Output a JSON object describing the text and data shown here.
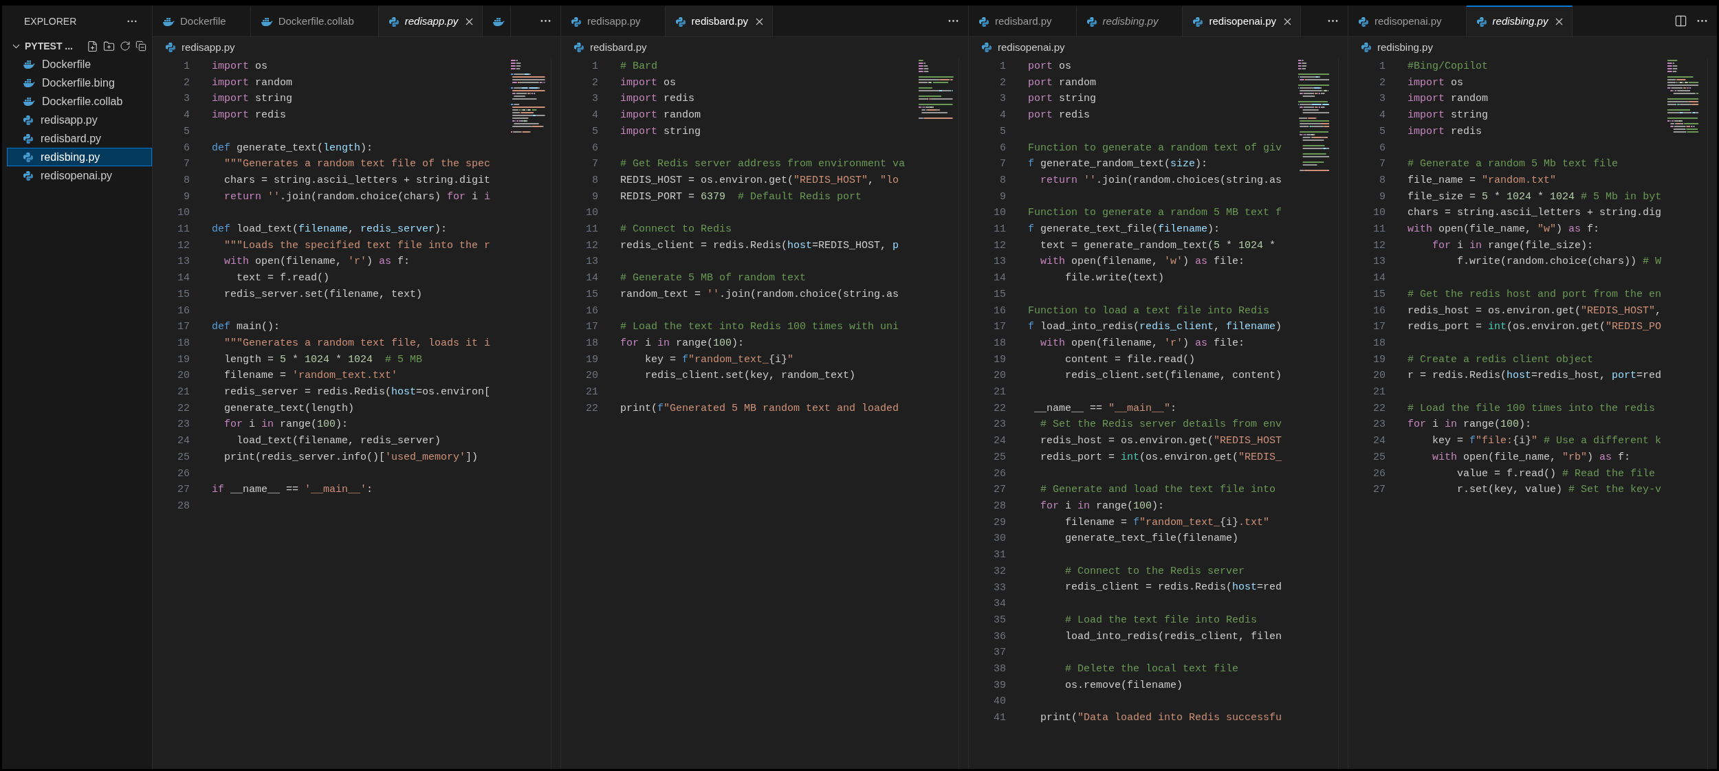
{
  "sidebar": {
    "title": "EXPLORER",
    "section": {
      "label": "PYTEST ...",
      "expanded": true
    },
    "files": [
      {
        "name": "Dockerfile",
        "kind": "docker",
        "selected": false
      },
      {
        "name": "Dockerfile.bing",
        "kind": "docker",
        "selected": false
      },
      {
        "name": "Dockerfile.collab",
        "kind": "docker",
        "selected": false
      },
      {
        "name": "redisapp.py",
        "kind": "python",
        "selected": false
      },
      {
        "name": "redisbard.py",
        "kind": "python",
        "selected": false
      },
      {
        "name": "redisbing.py",
        "kind": "python",
        "selected": true
      },
      {
        "name": "redisopenai.py",
        "kind": "python",
        "selected": false
      }
    ]
  },
  "editor_groups": [
    {
      "focused": false,
      "split_action": false,
      "tabs": [
        {
          "label": "Dockerfile",
          "kind": "docker",
          "selected": false,
          "preview": false
        },
        {
          "label": "Dockerfile.collab",
          "kind": "docker",
          "selected": false,
          "preview": false
        },
        {
          "label": "redisapp.py",
          "kind": "python",
          "selected": true,
          "preview": true
        },
        {
          "kind": "docker",
          "selected": false
        }
      ],
      "breadcrumb": {
        "label": "redisapp.py",
        "kind": "python"
      },
      "lines": [
        {
          "number": "1",
          "tokens": [
            {
              "kind": "kw",
              "text": "import"
            },
            {
              "kind": "txt",
              "text": " os"
            }
          ]
        },
        {
          "number": "2",
          "tokens": [
            {
              "kind": "kw",
              "text": "import"
            },
            {
              "kind": "txt",
              "text": " random"
            }
          ]
        },
        {
          "number": "3",
          "tokens": [
            {
              "kind": "kw",
              "text": "import"
            },
            {
              "kind": "txt",
              "text": " string"
            }
          ]
        },
        {
          "number": "4",
          "tokens": [
            {
              "kind": "kw",
              "text": "import"
            },
            {
              "kind": "txt",
              "text": " redis"
            }
          ]
        },
        {
          "number": "5"
        },
        {
          "number": "6",
          "tokens": [
            {
              "kind": "def",
              "text": "def"
            },
            {
              "kind": "txt",
              "text": " generate_text("
            },
            {
              "kind": "arg",
              "text": "length"
            },
            {
              "kind": "txt",
              "text": "):"
            }
          ]
        },
        {
          "number": "7",
          "tokens": [
            {
              "kind": "str",
              "text": "  \"\"\"Generates a random text file of the spec"
            }
          ]
        },
        {
          "number": "8",
          "tokens": [
            {
              "kind": "txt",
              "text": "  chars = string.ascii_letters + string.digit"
            }
          ]
        },
        {
          "number": "9",
          "tokens": [
            {
              "kind": "kw",
              "text": "  return"
            },
            {
              "kind": "str",
              "text": " ''"
            },
            {
              "kind": "txt",
              "text": ".join(random.choice(chars) "
            },
            {
              "kind": "kw",
              "text": "for"
            },
            {
              "kind": "txt",
              "text": " i "
            },
            {
              "kind": "kw",
              "text": "i"
            }
          ]
        },
        {
          "number": "10"
        },
        {
          "number": "11",
          "tokens": [
            {
              "kind": "def",
              "text": "def"
            },
            {
              "kind": "txt",
              "text": " load_text("
            },
            {
              "kind": "arg",
              "text": "filename"
            },
            {
              "kind": "txt",
              "text": ", "
            },
            {
              "kind": "arg",
              "text": "redis_server"
            },
            {
              "kind": "txt",
              "text": "):"
            }
          ]
        },
        {
          "number": "12",
          "tokens": [
            {
              "kind": "str",
              "text": "  \"\"\"Loads the specified text file into the r"
            }
          ]
        },
        {
          "number": "13",
          "tokens": [
            {
              "kind": "kw",
              "text": "  with"
            },
            {
              "kind": "txt",
              "text": " open(filename, "
            },
            {
              "kind": "str",
              "text": "'r'"
            },
            {
              "kind": "txt",
              "text": ") "
            },
            {
              "kind": "kw",
              "text": "as"
            },
            {
              "kind": "txt",
              "text": " f:"
            }
          ]
        },
        {
          "number": "14",
          "tokens": [
            {
              "kind": "txt",
              "text": "    text = f.read()"
            }
          ]
        },
        {
          "number": "15",
          "tokens": [
            {
              "kind": "txt",
              "text": "  redis_server.set(filename, text)"
            }
          ]
        },
        {
          "number": "16"
        },
        {
          "number": "17",
          "tokens": [
            {
              "kind": "def",
              "text": "def"
            },
            {
              "kind": "txt",
              "text": " main():"
            }
          ]
        },
        {
          "number": "18",
          "tokens": [
            {
              "kind": "str",
              "text": "  \"\"\"Generates a random text file, loads it i"
            }
          ]
        },
        {
          "number": "19",
          "tokens": [
            {
              "kind": "txt",
              "text": "  length = "
            },
            {
              "kind": "num",
              "text": "5"
            },
            {
              "kind": "txt",
              "text": " * "
            },
            {
              "kind": "num",
              "text": "1024"
            },
            {
              "kind": "txt",
              "text": " * "
            },
            {
              "kind": "num",
              "text": "1024"
            },
            {
              "kind": "com",
              "text": "  # 5 MB"
            }
          ]
        },
        {
          "number": "20",
          "tokens": [
            {
              "kind": "txt",
              "text": "  filename = "
            },
            {
              "kind": "str",
              "text": "'random_text.txt'"
            }
          ]
        },
        {
          "number": "21",
          "tokens": [
            {
              "kind": "txt",
              "text": "  redis_server = redis.Redis("
            },
            {
              "kind": "arg",
              "text": "host"
            },
            {
              "kind": "txt",
              "text": "=os.environ["
            }
          ]
        },
        {
          "number": "22",
          "tokens": [
            {
              "kind": "txt",
              "text": "  generate_text(length)"
            }
          ]
        },
        {
          "number": "23",
          "tokens": [
            {
              "kind": "kw",
              "text": "  for"
            },
            {
              "kind": "txt",
              "text": " i "
            },
            {
              "kind": "kw",
              "text": "in"
            },
            {
              "kind": "txt",
              "text": " range("
            },
            {
              "kind": "num",
              "text": "100"
            },
            {
              "kind": "txt",
              "text": "):"
            }
          ]
        },
        {
          "number": "24",
          "tokens": [
            {
              "kind": "txt",
              "text": "    load_text(filename, redis_server)"
            }
          ]
        },
        {
          "number": "25",
          "tokens": [
            {
              "kind": "txt",
              "text": "  print(redis_server.info()["
            },
            {
              "kind": "str",
              "text": "'used_memory'"
            },
            {
              "kind": "txt",
              "text": "])"
            }
          ]
        },
        {
          "number": "26"
        },
        {
          "number": "27",
          "tokens": [
            {
              "kind": "kw",
              "text": "if"
            },
            {
              "kind": "txt",
              "text": " __name__ == "
            },
            {
              "kind": "str",
              "text": "'__main__'"
            },
            {
              "kind": "txt",
              "text": ":"
            }
          ]
        },
        {
          "number": "28"
        }
      ]
    },
    {
      "focused": false,
      "split_action": false,
      "tabs": [
        {
          "label": "redisapp.py",
          "kind": "python",
          "selected": false,
          "preview": false
        },
        {
          "label": "redisbard.py",
          "kind": "python",
          "selected": true,
          "preview": false
        }
      ],
      "breadcrumb": {
        "label": "redisbard.py",
        "kind": "python"
      },
      "lines": [
        {
          "number": "1",
          "tokens": [
            {
              "kind": "com",
              "text": "# Bard"
            }
          ]
        },
        {
          "number": "2",
          "tokens": [
            {
              "kind": "kw",
              "text": "import"
            },
            {
              "kind": "txt",
              "text": " os"
            }
          ]
        },
        {
          "number": "3",
          "tokens": [
            {
              "kind": "kw",
              "text": "import"
            },
            {
              "kind": "txt",
              "text": " redis"
            }
          ]
        },
        {
          "number": "4",
          "tokens": [
            {
              "kind": "kw",
              "text": "import"
            },
            {
              "kind": "txt",
              "text": " random"
            }
          ]
        },
        {
          "number": "5",
          "tokens": [
            {
              "kind": "kw",
              "text": "import"
            },
            {
              "kind": "txt",
              "text": " string"
            }
          ]
        },
        {
          "number": "6"
        },
        {
          "number": "7",
          "tokens": [
            {
              "kind": "com",
              "text": "# Get Redis server address from environment va"
            }
          ]
        },
        {
          "number": "8",
          "tokens": [
            {
              "kind": "txt",
              "text": "REDIS_HOST = os.environ.get("
            },
            {
              "kind": "str",
              "text": "\"REDIS_HOST\""
            },
            {
              "kind": "txt",
              "text": ", "
            },
            {
              "kind": "str",
              "text": "\"lo"
            }
          ]
        },
        {
          "number": "9",
          "tokens": [
            {
              "kind": "txt",
              "text": "REDIS_PORT = "
            },
            {
              "kind": "num",
              "text": "6379"
            },
            {
              "kind": "com",
              "text": "  # Default Redis port"
            }
          ]
        },
        {
          "number": "10"
        },
        {
          "number": "11",
          "tokens": [
            {
              "kind": "com",
              "text": "# Connect to Redis"
            }
          ]
        },
        {
          "number": "12",
          "tokens": [
            {
              "kind": "txt",
              "text": "redis_client = redis.Redis("
            },
            {
              "kind": "arg",
              "text": "host"
            },
            {
              "kind": "txt",
              "text": "=REDIS_HOST, "
            },
            {
              "kind": "arg",
              "text": "p"
            }
          ]
        },
        {
          "number": "13"
        },
        {
          "number": "14",
          "tokens": [
            {
              "kind": "com",
              "text": "# Generate 5 MB of random text"
            }
          ]
        },
        {
          "number": "15",
          "tokens": [
            {
              "kind": "txt",
              "text": "random_text = "
            },
            {
              "kind": "str",
              "text": "''"
            },
            {
              "kind": "txt",
              "text": ".join(random.choice(string.as"
            }
          ]
        },
        {
          "number": "16"
        },
        {
          "number": "17",
          "tokens": [
            {
              "kind": "com",
              "text": "# Load the text into Redis 100 times with uni"
            }
          ]
        },
        {
          "number": "18",
          "tokens": [
            {
              "kind": "kw",
              "text": "for"
            },
            {
              "kind": "txt",
              "text": " i "
            },
            {
              "kind": "kw",
              "text": "in"
            },
            {
              "kind": "txt",
              "text": " range("
            },
            {
              "kind": "num",
              "text": "100"
            },
            {
              "kind": "txt",
              "text": "):"
            }
          ]
        },
        {
          "number": "19",
          "tokens": [
            {
              "kind": "txt",
              "text": "    key = "
            },
            {
              "kind": "def",
              "text": "f"
            },
            {
              "kind": "str",
              "text": "\"random_text_"
            },
            {
              "kind": "txt",
              "text": "{i}"
            },
            {
              "kind": "str",
              "text": "\""
            }
          ]
        },
        {
          "number": "20",
          "tokens": [
            {
              "kind": "txt",
              "text": "    redis_client.set(key, random_text)"
            }
          ]
        },
        {
          "number": "21"
        },
        {
          "number": "22",
          "tokens": [
            {
              "kind": "txt",
              "text": "print("
            },
            {
              "kind": "def",
              "text": "f"
            },
            {
              "kind": "str",
              "text": "\"Generated 5 MB random text and loaded"
            }
          ]
        }
      ]
    },
    {
      "focused": false,
      "split_action": false,
      "tabs": [
        {
          "label": "redisbard.py",
          "kind": "python",
          "selected": false,
          "preview": false
        },
        {
          "label": "redisbing.py",
          "kind": "python",
          "selected": false,
          "preview": true
        },
        {
          "label": "redisopenai.py",
          "kind": "python",
          "selected": true,
          "preview": false
        }
      ],
      "breadcrumb": {
        "label": "redisopenai.py",
        "kind": "python"
      },
      "lines": [
        {
          "number": "1",
          "tokens": [
            {
              "kind": "kw",
              "text": "port"
            },
            {
              "kind": "txt",
              "text": " os"
            }
          ]
        },
        {
          "number": "2",
          "tokens": [
            {
              "kind": "kw",
              "text": "port"
            },
            {
              "kind": "txt",
              "text": " random"
            }
          ]
        },
        {
          "number": "3",
          "tokens": [
            {
              "kind": "kw",
              "text": "port"
            },
            {
              "kind": "txt",
              "text": " string"
            }
          ]
        },
        {
          "number": "4",
          "tokens": [
            {
              "kind": "kw",
              "text": "port"
            },
            {
              "kind": "txt",
              "text": " redis"
            }
          ]
        },
        {
          "number": "5"
        },
        {
          "number": "6",
          "tokens": [
            {
              "kind": "com",
              "text": "Function to generate a random text of giv"
            }
          ]
        },
        {
          "number": "7",
          "tokens": [
            {
              "kind": "def",
              "text": "f"
            },
            {
              "kind": "txt",
              "text": " generate_random_text("
            },
            {
              "kind": "arg",
              "text": "size"
            },
            {
              "kind": "txt",
              "text": "):"
            }
          ]
        },
        {
          "number": "8",
          "tokens": [
            {
              "kind": "kw",
              "text": "  return"
            },
            {
              "kind": "str",
              "text": " ''"
            },
            {
              "kind": "txt",
              "text": ".join(random.choices(string.as"
            }
          ]
        },
        {
          "number": "9"
        },
        {
          "number": "10",
          "tokens": [
            {
              "kind": "com",
              "text": "Function to generate a random 5 MB text f"
            }
          ]
        },
        {
          "number": "11",
          "tokens": [
            {
              "kind": "def",
              "text": "f"
            },
            {
              "kind": "txt",
              "text": " generate_text_file("
            },
            {
              "kind": "arg",
              "text": "filename"
            },
            {
              "kind": "txt",
              "text": "):"
            }
          ]
        },
        {
          "number": "12",
          "tokens": [
            {
              "kind": "txt",
              "text": "  text = generate_random_text("
            },
            {
              "kind": "num",
              "text": "5"
            },
            {
              "kind": "txt",
              "text": " * "
            },
            {
              "kind": "num",
              "text": "1024"
            },
            {
              "kind": "txt",
              "text": " *"
            }
          ]
        },
        {
          "number": "13",
          "tokens": [
            {
              "kind": "kw",
              "text": "  with"
            },
            {
              "kind": "txt",
              "text": " open(filename, "
            },
            {
              "kind": "str",
              "text": "'w'"
            },
            {
              "kind": "txt",
              "text": ") "
            },
            {
              "kind": "kw",
              "text": "as"
            },
            {
              "kind": "txt",
              "text": " file:"
            }
          ]
        },
        {
          "number": "14",
          "tokens": [
            {
              "kind": "txt",
              "text": "      file.write(text)"
            }
          ]
        },
        {
          "number": "15"
        },
        {
          "number": "16",
          "tokens": [
            {
              "kind": "com",
              "text": "Function to load a text file into Redis"
            }
          ]
        },
        {
          "number": "17",
          "tokens": [
            {
              "kind": "def",
              "text": "f"
            },
            {
              "kind": "txt",
              "text": " load_into_redis("
            },
            {
              "kind": "arg",
              "text": "redis_client"
            },
            {
              "kind": "txt",
              "text": ", "
            },
            {
              "kind": "arg",
              "text": "filename"
            },
            {
              "kind": "txt",
              "text": ")"
            }
          ]
        },
        {
          "number": "18",
          "tokens": [
            {
              "kind": "kw",
              "text": "  with"
            },
            {
              "kind": "txt",
              "text": " open(filename, "
            },
            {
              "kind": "str",
              "text": "'r'"
            },
            {
              "kind": "txt",
              "text": ") "
            },
            {
              "kind": "kw",
              "text": "as"
            },
            {
              "kind": "txt",
              "text": " file:"
            }
          ]
        },
        {
          "number": "19",
          "tokens": [
            {
              "kind": "txt",
              "text": "      content = file.read()"
            }
          ]
        },
        {
          "number": "20",
          "tokens": [
            {
              "kind": "txt",
              "text": "      redis_client.set(filename, content)"
            }
          ]
        },
        {
          "number": "21"
        },
        {
          "number": "22",
          "tokens": [
            {
              "kind": "txt",
              "text": " __name__ == "
            },
            {
              "kind": "str",
              "text": "\"__main__\""
            },
            {
              "kind": "txt",
              "text": ":"
            }
          ]
        },
        {
          "number": "23",
          "tokens": [
            {
              "kind": "com",
              "text": "  # Set the Redis server details from env"
            }
          ]
        },
        {
          "number": "24",
          "tokens": [
            {
              "kind": "txt",
              "text": "  redis_host = os.environ.get("
            },
            {
              "kind": "str",
              "text": "\"REDIS_HOST"
            }
          ]
        },
        {
          "number": "25",
          "tokens": [
            {
              "kind": "txt",
              "text": "  redis_port = "
            },
            {
              "kind": "type",
              "text": "int"
            },
            {
              "kind": "txt",
              "text": "(os.environ.get("
            },
            {
              "kind": "str",
              "text": "\"REDIS_"
            }
          ]
        },
        {
          "number": "26"
        },
        {
          "number": "27",
          "tokens": [
            {
              "kind": "com",
              "text": "  # Generate and load the text file into"
            }
          ]
        },
        {
          "number": "28",
          "tokens": [
            {
              "kind": "kw",
              "text": "  for"
            },
            {
              "kind": "txt",
              "text": " i "
            },
            {
              "kind": "kw",
              "text": "in"
            },
            {
              "kind": "txt",
              "text": " range("
            },
            {
              "kind": "num",
              "text": "100"
            },
            {
              "kind": "txt",
              "text": "):"
            }
          ]
        },
        {
          "number": "29",
          "tokens": [
            {
              "kind": "txt",
              "text": "      filename = "
            },
            {
              "kind": "def",
              "text": "f"
            },
            {
              "kind": "str",
              "text": "\"random_text_"
            },
            {
              "kind": "txt",
              "text": "{i}"
            },
            {
              "kind": "str",
              "text": ".txt\""
            }
          ]
        },
        {
          "number": "30",
          "tokens": [
            {
              "kind": "txt",
              "text": "      generate_text_file(filename)"
            }
          ]
        },
        {
          "number": "31"
        },
        {
          "number": "32",
          "tokens": [
            {
              "kind": "com",
              "text": "      # Connect to the Redis server"
            }
          ]
        },
        {
          "number": "33",
          "tokens": [
            {
              "kind": "txt",
              "text": "      redis_client = redis.Redis("
            },
            {
              "kind": "arg",
              "text": "host"
            },
            {
              "kind": "txt",
              "text": "=red"
            }
          ]
        },
        {
          "number": "34"
        },
        {
          "number": "35",
          "tokens": [
            {
              "kind": "com",
              "text": "      # Load the text file into Redis"
            }
          ]
        },
        {
          "number": "36",
          "tokens": [
            {
              "kind": "txt",
              "text": "      load_into_redis(redis_client, filen"
            }
          ]
        },
        {
          "number": "37"
        },
        {
          "number": "38",
          "tokens": [
            {
              "kind": "com",
              "text": "      # Delete the local text file"
            }
          ]
        },
        {
          "number": "39",
          "tokens": [
            {
              "kind": "txt",
              "text": "      os.remove(filename)"
            }
          ]
        },
        {
          "number": "40"
        },
        {
          "number": "41",
          "tokens": [
            {
              "kind": "txt",
              "text": "  print("
            },
            {
              "kind": "str",
              "text": "\"Data loaded into Redis successfu"
            }
          ]
        }
      ]
    },
    {
      "focused": true,
      "split_action": true,
      "tabs": [
        {
          "label": "redisopenai.py",
          "kind": "python",
          "selected": false,
          "preview": false
        },
        {
          "label": "redisbing.py",
          "kind": "python",
          "selected": true,
          "preview": true
        }
      ],
      "breadcrumb": {
        "label": "redisbing.py",
        "kind": "python"
      },
      "lines": [
        {
          "number": "1",
          "tokens": [
            {
              "kind": "com",
              "text": "#Bing/Copilot"
            }
          ]
        },
        {
          "number": "2",
          "tokens": [
            {
              "kind": "kw",
              "text": "import"
            },
            {
              "kind": "txt",
              "text": " os"
            }
          ]
        },
        {
          "number": "3",
          "tokens": [
            {
              "kind": "kw",
              "text": "import"
            },
            {
              "kind": "txt",
              "text": " random"
            }
          ]
        },
        {
          "number": "4",
          "tokens": [
            {
              "kind": "kw",
              "text": "import"
            },
            {
              "kind": "txt",
              "text": " string"
            }
          ]
        },
        {
          "number": "5",
          "tokens": [
            {
              "kind": "kw",
              "text": "import"
            },
            {
              "kind": "txt",
              "text": " redis"
            }
          ]
        },
        {
          "number": "6"
        },
        {
          "number": "7",
          "tokens": [
            {
              "kind": "com",
              "text": "# Generate a random 5 Mb text file"
            }
          ]
        },
        {
          "number": "8",
          "tokens": [
            {
              "kind": "txt",
              "text": "file_name = "
            },
            {
              "kind": "str",
              "text": "\"random.txt\""
            }
          ]
        },
        {
          "number": "9",
          "tokens": [
            {
              "kind": "txt",
              "text": "file_size = "
            },
            {
              "kind": "num",
              "text": "5"
            },
            {
              "kind": "txt",
              "text": " * "
            },
            {
              "kind": "num",
              "text": "1024"
            },
            {
              "kind": "txt",
              "text": " * "
            },
            {
              "kind": "num",
              "text": "1024"
            },
            {
              "kind": "com",
              "text": " # 5 Mb in byt"
            }
          ]
        },
        {
          "number": "10",
          "tokens": [
            {
              "kind": "txt",
              "text": "chars = string.ascii_letters + string.dig"
            }
          ]
        },
        {
          "number": "11",
          "tokens": [
            {
              "kind": "kw",
              "text": "with"
            },
            {
              "kind": "txt",
              "text": " open(file_name, "
            },
            {
              "kind": "str",
              "text": "\"w\""
            },
            {
              "kind": "txt",
              "text": ") "
            },
            {
              "kind": "kw",
              "text": "as"
            },
            {
              "kind": "txt",
              "text": " f:"
            }
          ]
        },
        {
          "number": "12",
          "tokens": [
            {
              "kind": "kw",
              "text": "    for"
            },
            {
              "kind": "txt",
              "text": " i "
            },
            {
              "kind": "kw",
              "text": "in"
            },
            {
              "kind": "txt",
              "text": " range(file_size):"
            }
          ]
        },
        {
          "number": "13",
          "tokens": [
            {
              "kind": "txt",
              "text": "        f.write(random.choice(chars)) "
            },
            {
              "kind": "com",
              "text": "# W"
            }
          ]
        },
        {
          "number": "14"
        },
        {
          "number": "15",
          "tokens": [
            {
              "kind": "com",
              "text": "# Get the redis host and port from the en"
            }
          ]
        },
        {
          "number": "16",
          "tokens": [
            {
              "kind": "txt",
              "text": "redis_host = os.environ.get("
            },
            {
              "kind": "str",
              "text": "\"REDIS_HOST\""
            },
            {
              "kind": "txt",
              "text": ","
            }
          ]
        },
        {
          "number": "17",
          "tokens": [
            {
              "kind": "txt",
              "text": "redis_port = "
            },
            {
              "kind": "type",
              "text": "int"
            },
            {
              "kind": "txt",
              "text": "(os.environ.get("
            },
            {
              "kind": "str",
              "text": "\"REDIS_PO"
            }
          ]
        },
        {
          "number": "18"
        },
        {
          "number": "19",
          "tokens": [
            {
              "kind": "com",
              "text": "# Create a redis client object"
            }
          ]
        },
        {
          "number": "20",
          "tokens": [
            {
              "kind": "txt",
              "text": "r = redis.Redis("
            },
            {
              "kind": "arg",
              "text": "host"
            },
            {
              "kind": "txt",
              "text": "=redis_host, "
            },
            {
              "kind": "arg",
              "text": "port"
            },
            {
              "kind": "txt",
              "text": "=red"
            }
          ]
        },
        {
          "number": "21"
        },
        {
          "number": "22",
          "tokens": [
            {
              "kind": "com",
              "text": "# Load the file 100 times into the redis"
            }
          ]
        },
        {
          "number": "23",
          "tokens": [
            {
              "kind": "kw",
              "text": "for"
            },
            {
              "kind": "txt",
              "text": " i "
            },
            {
              "kind": "kw",
              "text": "in"
            },
            {
              "kind": "txt",
              "text": " range("
            },
            {
              "kind": "num",
              "text": "100"
            },
            {
              "kind": "txt",
              "text": "):"
            }
          ]
        },
        {
          "number": "24",
          "tokens": [
            {
              "kind": "txt",
              "text": "    key = "
            },
            {
              "kind": "def",
              "text": "f"
            },
            {
              "kind": "str",
              "text": "\"file:"
            },
            {
              "kind": "txt",
              "text": "{i}"
            },
            {
              "kind": "str",
              "text": "\""
            },
            {
              "kind": "com",
              "text": " # Use a different k"
            }
          ]
        },
        {
          "number": "25",
          "tokens": [
            {
              "kind": "kw",
              "text": "    with"
            },
            {
              "kind": "txt",
              "text": " open(file_name, "
            },
            {
              "kind": "str",
              "text": "\"rb\""
            },
            {
              "kind": "txt",
              "text": ") "
            },
            {
              "kind": "kw",
              "text": "as"
            },
            {
              "kind": "txt",
              "text": " f:"
            }
          ]
        },
        {
          "number": "26",
          "tokens": [
            {
              "kind": "txt",
              "text": "        value = f.read() "
            },
            {
              "kind": "com",
              "text": "# Read the file"
            }
          ]
        },
        {
          "number": "27",
          "tokens": [
            {
              "kind": "txt",
              "text": "        r.set(key, value) "
            },
            {
              "kind": "com",
              "text": "# Set the key-v"
            }
          ]
        }
      ]
    }
  ]
}
